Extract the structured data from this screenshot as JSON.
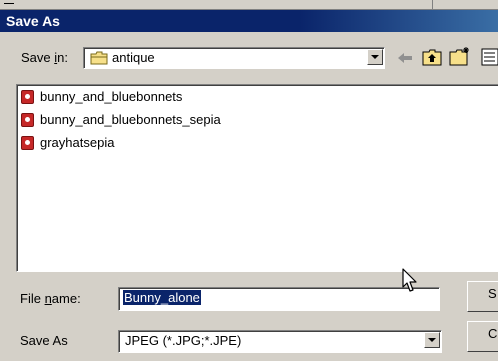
{
  "dialog": {
    "title": "Save As"
  },
  "save_in": {
    "label_prefix": "Save ",
    "label_mnemonic": "i",
    "label_suffix": "n:",
    "value": "antique",
    "icon": "folder-icon"
  },
  "toolbar": {
    "icons": [
      "back-arrow-icon",
      "up-folder-icon",
      "new-folder-icon",
      "view-menu-icon"
    ]
  },
  "files": [
    {
      "name": "bunny_and_bluebonnets",
      "icon": "image-file-icon"
    },
    {
      "name": "bunny_and_bluebonnets_sepia",
      "icon": "image-file-icon"
    },
    {
      "name": "grayhatsepia",
      "icon": "image-file-icon"
    }
  ],
  "file_name": {
    "label_prefix": "File ",
    "label_mnemonic": "n",
    "label_suffix": "ame:",
    "value": "Bunny_alone"
  },
  "save_as_type": {
    "label": "Save As",
    "value": "JPEG (*.JPG;*.JPE)"
  },
  "buttons": {
    "save_label": "S",
    "cancel_label": "C"
  },
  "colors": {
    "title_bar": "#0a246a",
    "dialog_face": "#d4d0c8",
    "selection": "#0a246a"
  }
}
